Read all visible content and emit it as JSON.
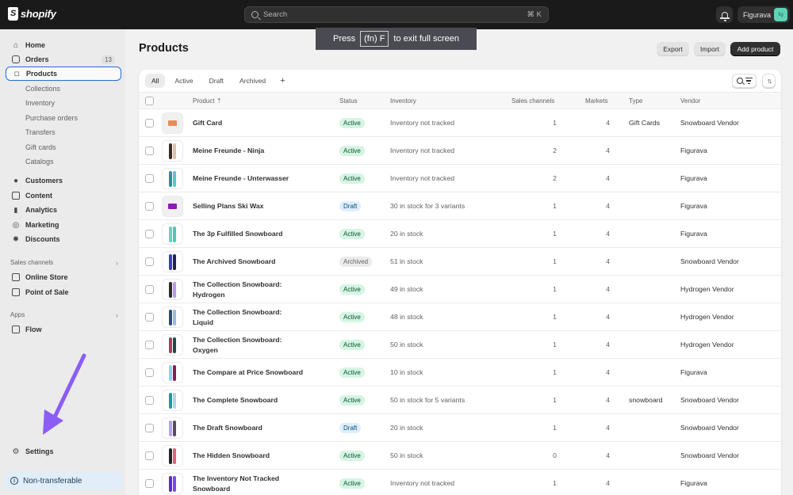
{
  "topbar": {
    "brand": "shopify",
    "search_placeholder": "Search",
    "search_shortcut": "⌘ K",
    "store_name": "Figurava",
    "store_avatar": "fig"
  },
  "fullscreen_banner": {
    "prefix": "Press",
    "key": "(fn) F",
    "suffix": "to exit full screen"
  },
  "sidebar": {
    "main": [
      {
        "label": "Home",
        "icon": "home-icon"
      },
      {
        "label": "Orders",
        "icon": "inbox-icon",
        "badge": "13"
      },
      {
        "label": "Products",
        "icon": "tag-icon",
        "active": true
      }
    ],
    "product_sub": [
      "Collections",
      "Inventory",
      "Purchase orders",
      "Transfers",
      "Gift cards",
      "Catalogs"
    ],
    "secondary": [
      {
        "label": "Customers",
        "icon": "person-icon"
      },
      {
        "label": "Content",
        "icon": "image-icon"
      },
      {
        "label": "Analytics",
        "icon": "bar-chart-icon"
      },
      {
        "label": "Marketing",
        "icon": "target-icon"
      },
      {
        "label": "Discounts",
        "icon": "discount-icon"
      }
    ],
    "sales_channels_heading": "Sales channels",
    "sales_channels": [
      {
        "label": "Online Store",
        "icon": "store-icon"
      },
      {
        "label": "Point of Sale",
        "icon": "pos-icon"
      }
    ],
    "apps_heading": "Apps",
    "apps": [
      {
        "label": "Flow",
        "icon": "flow-icon"
      }
    ],
    "settings": "Settings",
    "non_transferable": "Non-transferable"
  },
  "page": {
    "title": "Products",
    "export_label": "Export",
    "import_label": "Import",
    "add_product_label": "Add product"
  },
  "tabs": [
    "All",
    "Active",
    "Draft",
    "Archived"
  ],
  "tab_add": "+",
  "columns": {
    "product": "Product",
    "status": "Status",
    "inventory": "Inventory",
    "sales_channels": "Sales channels",
    "markets": "Markets",
    "type": "Type",
    "vendor": "Vendor"
  },
  "products": [
    {
      "name": "Gift Card",
      "status": "Active",
      "inventory": "Inventory not tracked",
      "channels": "1",
      "markets": "4",
      "type": "Gift Cards",
      "vendor": "Snowboard Vendor"
    },
    {
      "name": "Meine Freunde - Ninja",
      "status": "Active",
      "inventory": "Inventory not tracked",
      "channels": "2",
      "markets": "4",
      "type": "",
      "vendor": "Figurava"
    },
    {
      "name": "Meine Freunde - Unterwasser",
      "status": "Active",
      "inventory": "Inventory not tracked",
      "channels": "2",
      "markets": "4",
      "type": "",
      "vendor": "Figurava"
    },
    {
      "name": "Selling Plans Ski Wax",
      "status": "Draft",
      "inventory": "30 in stock for 3 variants",
      "channels": "1",
      "markets": "4",
      "type": "",
      "vendor": "Figurava"
    },
    {
      "name": "The 3p Fulfilled Snowboard",
      "status": "Active",
      "inventory": "20 in stock",
      "channels": "1",
      "markets": "4",
      "type": "",
      "vendor": "Figurava"
    },
    {
      "name": "The Archived Snowboard",
      "status": "Archived",
      "inventory": "51 in stock",
      "channels": "1",
      "markets": "4",
      "type": "",
      "vendor": "Snowboard Vendor"
    },
    {
      "name": "The Collection Snowboard: Hydrogen",
      "status": "Active",
      "inventory": "49 in stock",
      "channels": "1",
      "markets": "4",
      "type": "",
      "vendor": "Hydrogen Vendor"
    },
    {
      "name": "The Collection Snowboard: Liquid",
      "status": "Active",
      "inventory": "48 in stock",
      "channels": "1",
      "markets": "4",
      "type": "",
      "vendor": "Hydrogen Vendor"
    },
    {
      "name": "The Collection Snowboard: Oxygen",
      "status": "Active",
      "inventory": "50 in stock",
      "channels": "1",
      "markets": "4",
      "type": "",
      "vendor": "Hydrogen Vendor"
    },
    {
      "name": "The Compare at Price Snowboard",
      "status": "Active",
      "inventory": "10 in stock",
      "channels": "1",
      "markets": "4",
      "type": "",
      "vendor": "Figurava"
    },
    {
      "name": "The Complete Snowboard",
      "status": "Active",
      "inventory": "50 in stock for 5 variants",
      "channels": "1",
      "markets": "4",
      "type": "snowboard",
      "vendor": "Snowboard Vendor"
    },
    {
      "name": "The Draft Snowboard",
      "status": "Draft",
      "inventory": "20 in stock",
      "channels": "1",
      "markets": "4",
      "type": "",
      "vendor": "Snowboard Vendor"
    },
    {
      "name": "The Hidden Snowboard",
      "status": "Active",
      "inventory": "50 in stock",
      "channels": "0",
      "markets": "4",
      "type": "",
      "vendor": "Snowboard Vendor"
    },
    {
      "name": "The Inventory Not Tracked Snowboard",
      "status": "Active",
      "inventory": "Inventory not tracked",
      "channels": "1",
      "markets": "4",
      "type": "",
      "vendor": "Figurava"
    }
  ],
  "thumb_colors": [
    [
      "#f08a4b"
    ],
    [
      "#3a2a22",
      "#d9c2b0"
    ],
    [
      "#2a8fa0",
      "#5fc3c9"
    ],
    [
      "#8b1ab8"
    ],
    [
      "#5fd6c0",
      "#4fc7b2"
    ],
    [
      "#3a3ec9",
      "#22244f"
    ],
    [
      "#2b2b2b",
      "#b99ae0"
    ],
    [
      "#2d4a7a",
      "#9fb8d8"
    ],
    [
      "#b23a5a",
      "#1f4a48"
    ],
    [
      "#8fd0f0",
      "#8a1a5a"
    ],
    [
      "#1e9b9b",
      "#b0d8e0"
    ],
    [
      "#b3a5f0",
      "#5a4a6a"
    ],
    [
      "#222222",
      "#f05a7a"
    ],
    [
      "#5a2ad8",
      "#7a4af0"
    ]
  ],
  "colors": {
    "accent_focus": "#2c6ecb",
    "status_active_bg": "#d5f5e3",
    "status_draft_bg": "#e0eefb",
    "status_archived_bg": "#ebebeb",
    "annotation_arrow": "#8b5cf6"
  }
}
